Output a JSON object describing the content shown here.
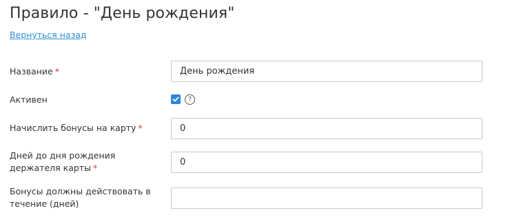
{
  "header": {
    "title": "Правило - \"День рождения\"",
    "back_link": "Вернуться назад"
  },
  "form": {
    "name": {
      "label": "Название",
      "required_mark": "*",
      "value": "День рождения"
    },
    "active": {
      "label": "Активен",
      "checked": true,
      "help_icon": "question-circle-icon",
      "help_glyph": "?"
    },
    "bonus_amount": {
      "label": "Начислить бонусы на карту",
      "required_mark": "*",
      "value": "0"
    },
    "days_before": {
      "label": "Дней до дня рождения держателя карты",
      "required_mark": "*",
      "value": "0"
    },
    "validity_days": {
      "label": "Бонусы должны действовать в течение (дней)",
      "value": ""
    }
  },
  "colors": {
    "link": "#2a8fd6",
    "required": "#e0313b",
    "checkbox": "#2e86d4",
    "input_border": "#c8c8c8"
  }
}
